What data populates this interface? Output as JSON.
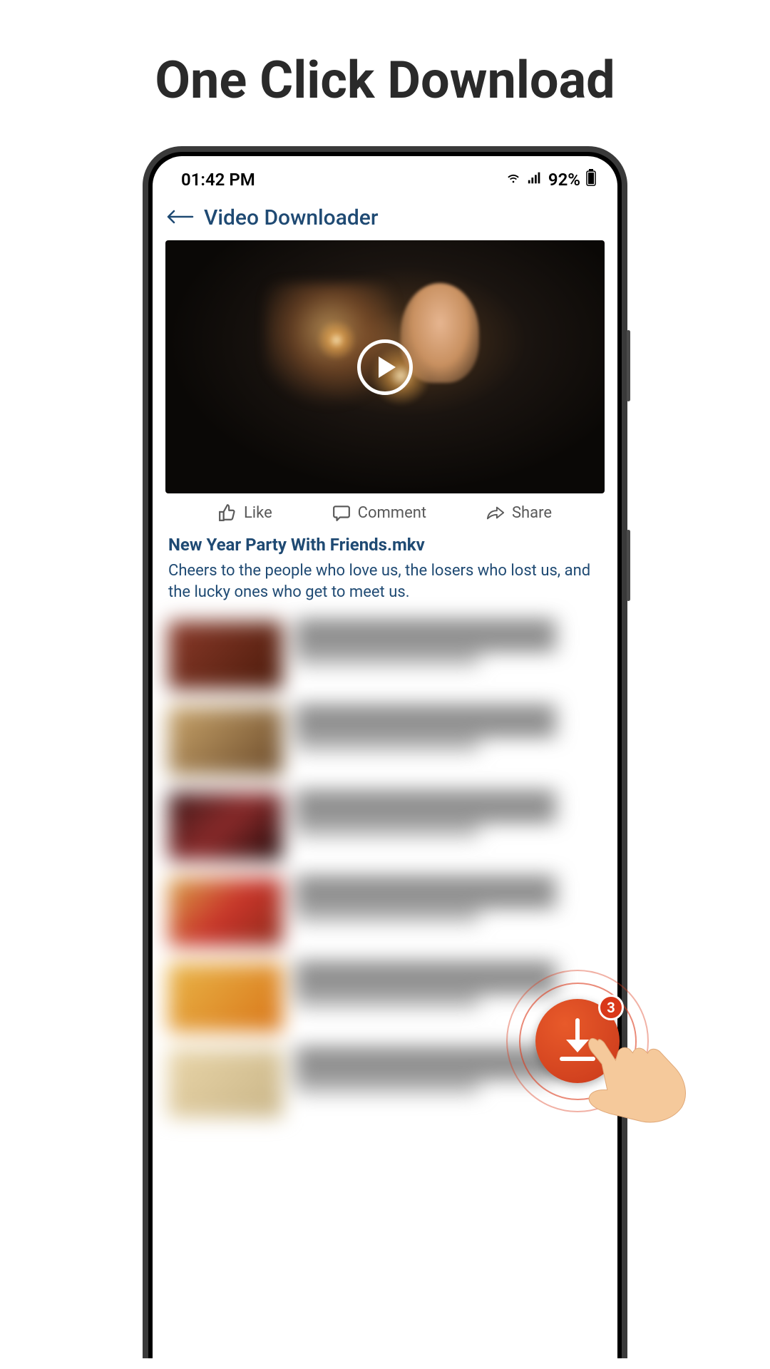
{
  "promo": {
    "title": "One Click Download"
  },
  "statusBar": {
    "time": "01:42 PM",
    "battery": "92%"
  },
  "header": {
    "title": "Video Downloader"
  },
  "actions": {
    "like": "Like",
    "comment": "Comment",
    "share": "Share"
  },
  "video": {
    "title": "New Year Party With Friends.mkv",
    "caption": "Cheers to the people who love us, the losers who lost us, and the lucky ones who get to meet us."
  },
  "fab": {
    "badge": "3"
  }
}
